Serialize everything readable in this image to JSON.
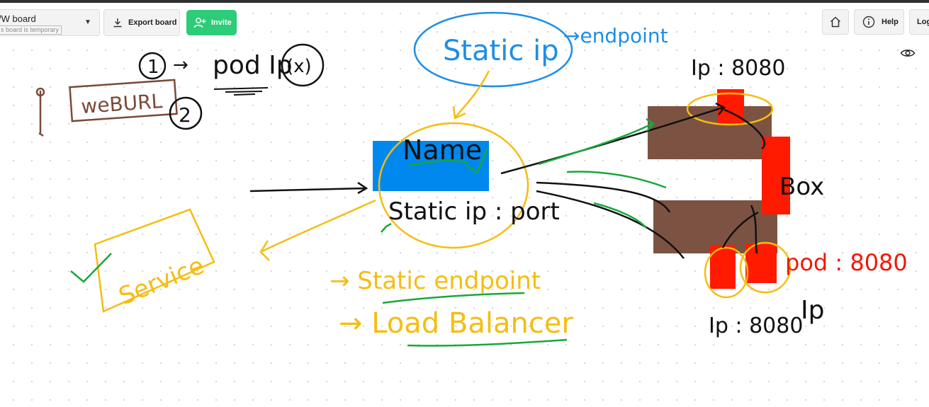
{
  "toolbar": {
    "board_title": "/W board",
    "temporary_note": "s board is temporary",
    "export_label": "Export board",
    "invite_label": "Invite",
    "help_label": "Help",
    "login_label": "Log"
  },
  "colors": {
    "invite_green": "#2ccc78",
    "ink_black": "#111111",
    "ink_yellow": "#f5bd12",
    "ink_blue": "#1d8ee6",
    "ink_green": "#18a83a",
    "ink_brown": "#7a4a3a",
    "ink_red": "#f01808",
    "block_blue": "#0088ee",
    "block_brown": "#7c5343",
    "block_red": "#ff1a00"
  },
  "board": {
    "top_left": {
      "num_1": "1",
      "arrow": "→",
      "pod_ip": "pod Ip",
      "circled_x": "(x)",
      "num_2": "2",
      "web_url": "weBURL"
    },
    "top_center": {
      "static_ip": "Static ip",
      "endpoint": "→endpoint"
    },
    "center": {
      "name": "Name",
      "static_ip_port": "Static ip : port"
    },
    "service": "Service",
    "bottom_center": {
      "static_endpoint": "→ Static endpoint",
      "load_balancer": "→ Load Balancer"
    },
    "right": {
      "ip_top": "Ip : 8080",
      "box": "Box",
      "pod_port": "pod : 8080",
      "ip_bottom": "Ip : 8080",
      "ip_small": "Ip"
    }
  }
}
